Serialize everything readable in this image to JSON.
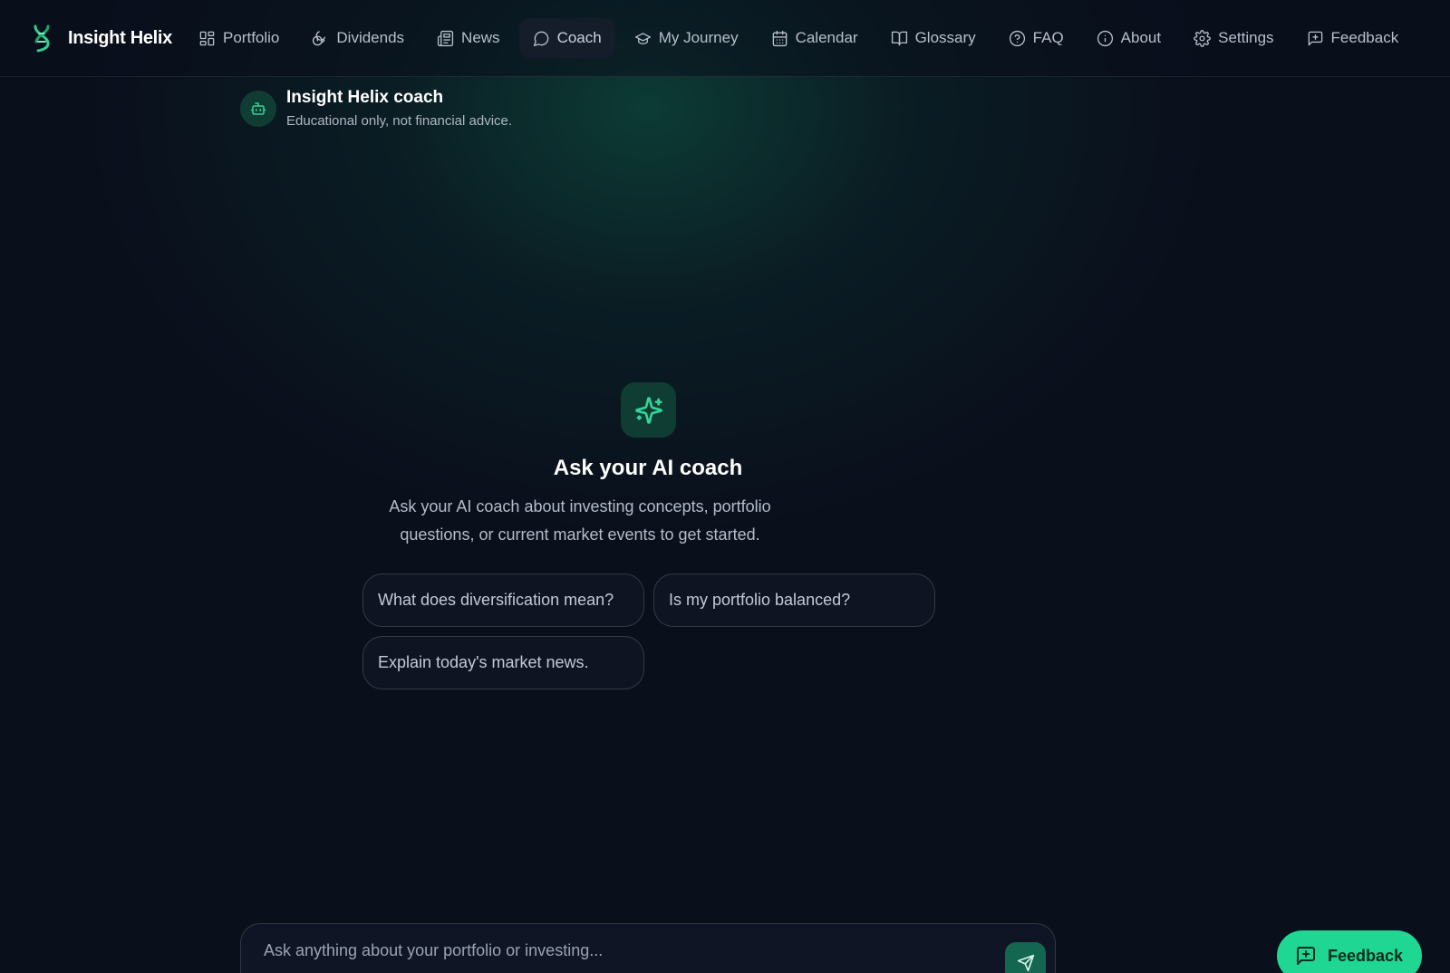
{
  "app": {
    "name": "Insight Helix"
  },
  "nav": {
    "items": [
      {
        "label": "Portfolio",
        "icon": "grid-icon"
      },
      {
        "label": "Dividends",
        "icon": "coins-icon"
      },
      {
        "label": "News",
        "icon": "newspaper-icon"
      },
      {
        "label": "Coach",
        "icon": "chat-bubble-icon",
        "active": true
      },
      {
        "label": "My Journey",
        "icon": "graduation-cap-icon"
      },
      {
        "label": "Calendar",
        "icon": "calendar-icon"
      },
      {
        "label": "Glossary",
        "icon": "book-open-icon"
      },
      {
        "label": "FAQ",
        "icon": "help-circle-icon"
      },
      {
        "label": "About",
        "icon": "info-icon"
      },
      {
        "label": "Settings",
        "icon": "gear-icon"
      },
      {
        "label": "Feedback",
        "icon": "message-plus-icon"
      }
    ]
  },
  "coach": {
    "title": "Insight Helix coach",
    "subtitle": "Educational only, not financial advice."
  },
  "empty_state": {
    "title": "Ask your AI coach",
    "description": "Ask your AI coach about investing concepts, portfolio questions, or current market events to get started.",
    "suggestions": [
      "What does diversification mean?",
      "Is my portfolio balanced?",
      "Explain today's market news."
    ]
  },
  "composer": {
    "placeholder": "Ask anything about your portfolio or investing...",
    "value": ""
  },
  "feedback_fab": {
    "label": "Feedback"
  },
  "colors": {
    "background": "#0a0f1c",
    "accent": "#34d399",
    "fab": "#1fd692"
  }
}
